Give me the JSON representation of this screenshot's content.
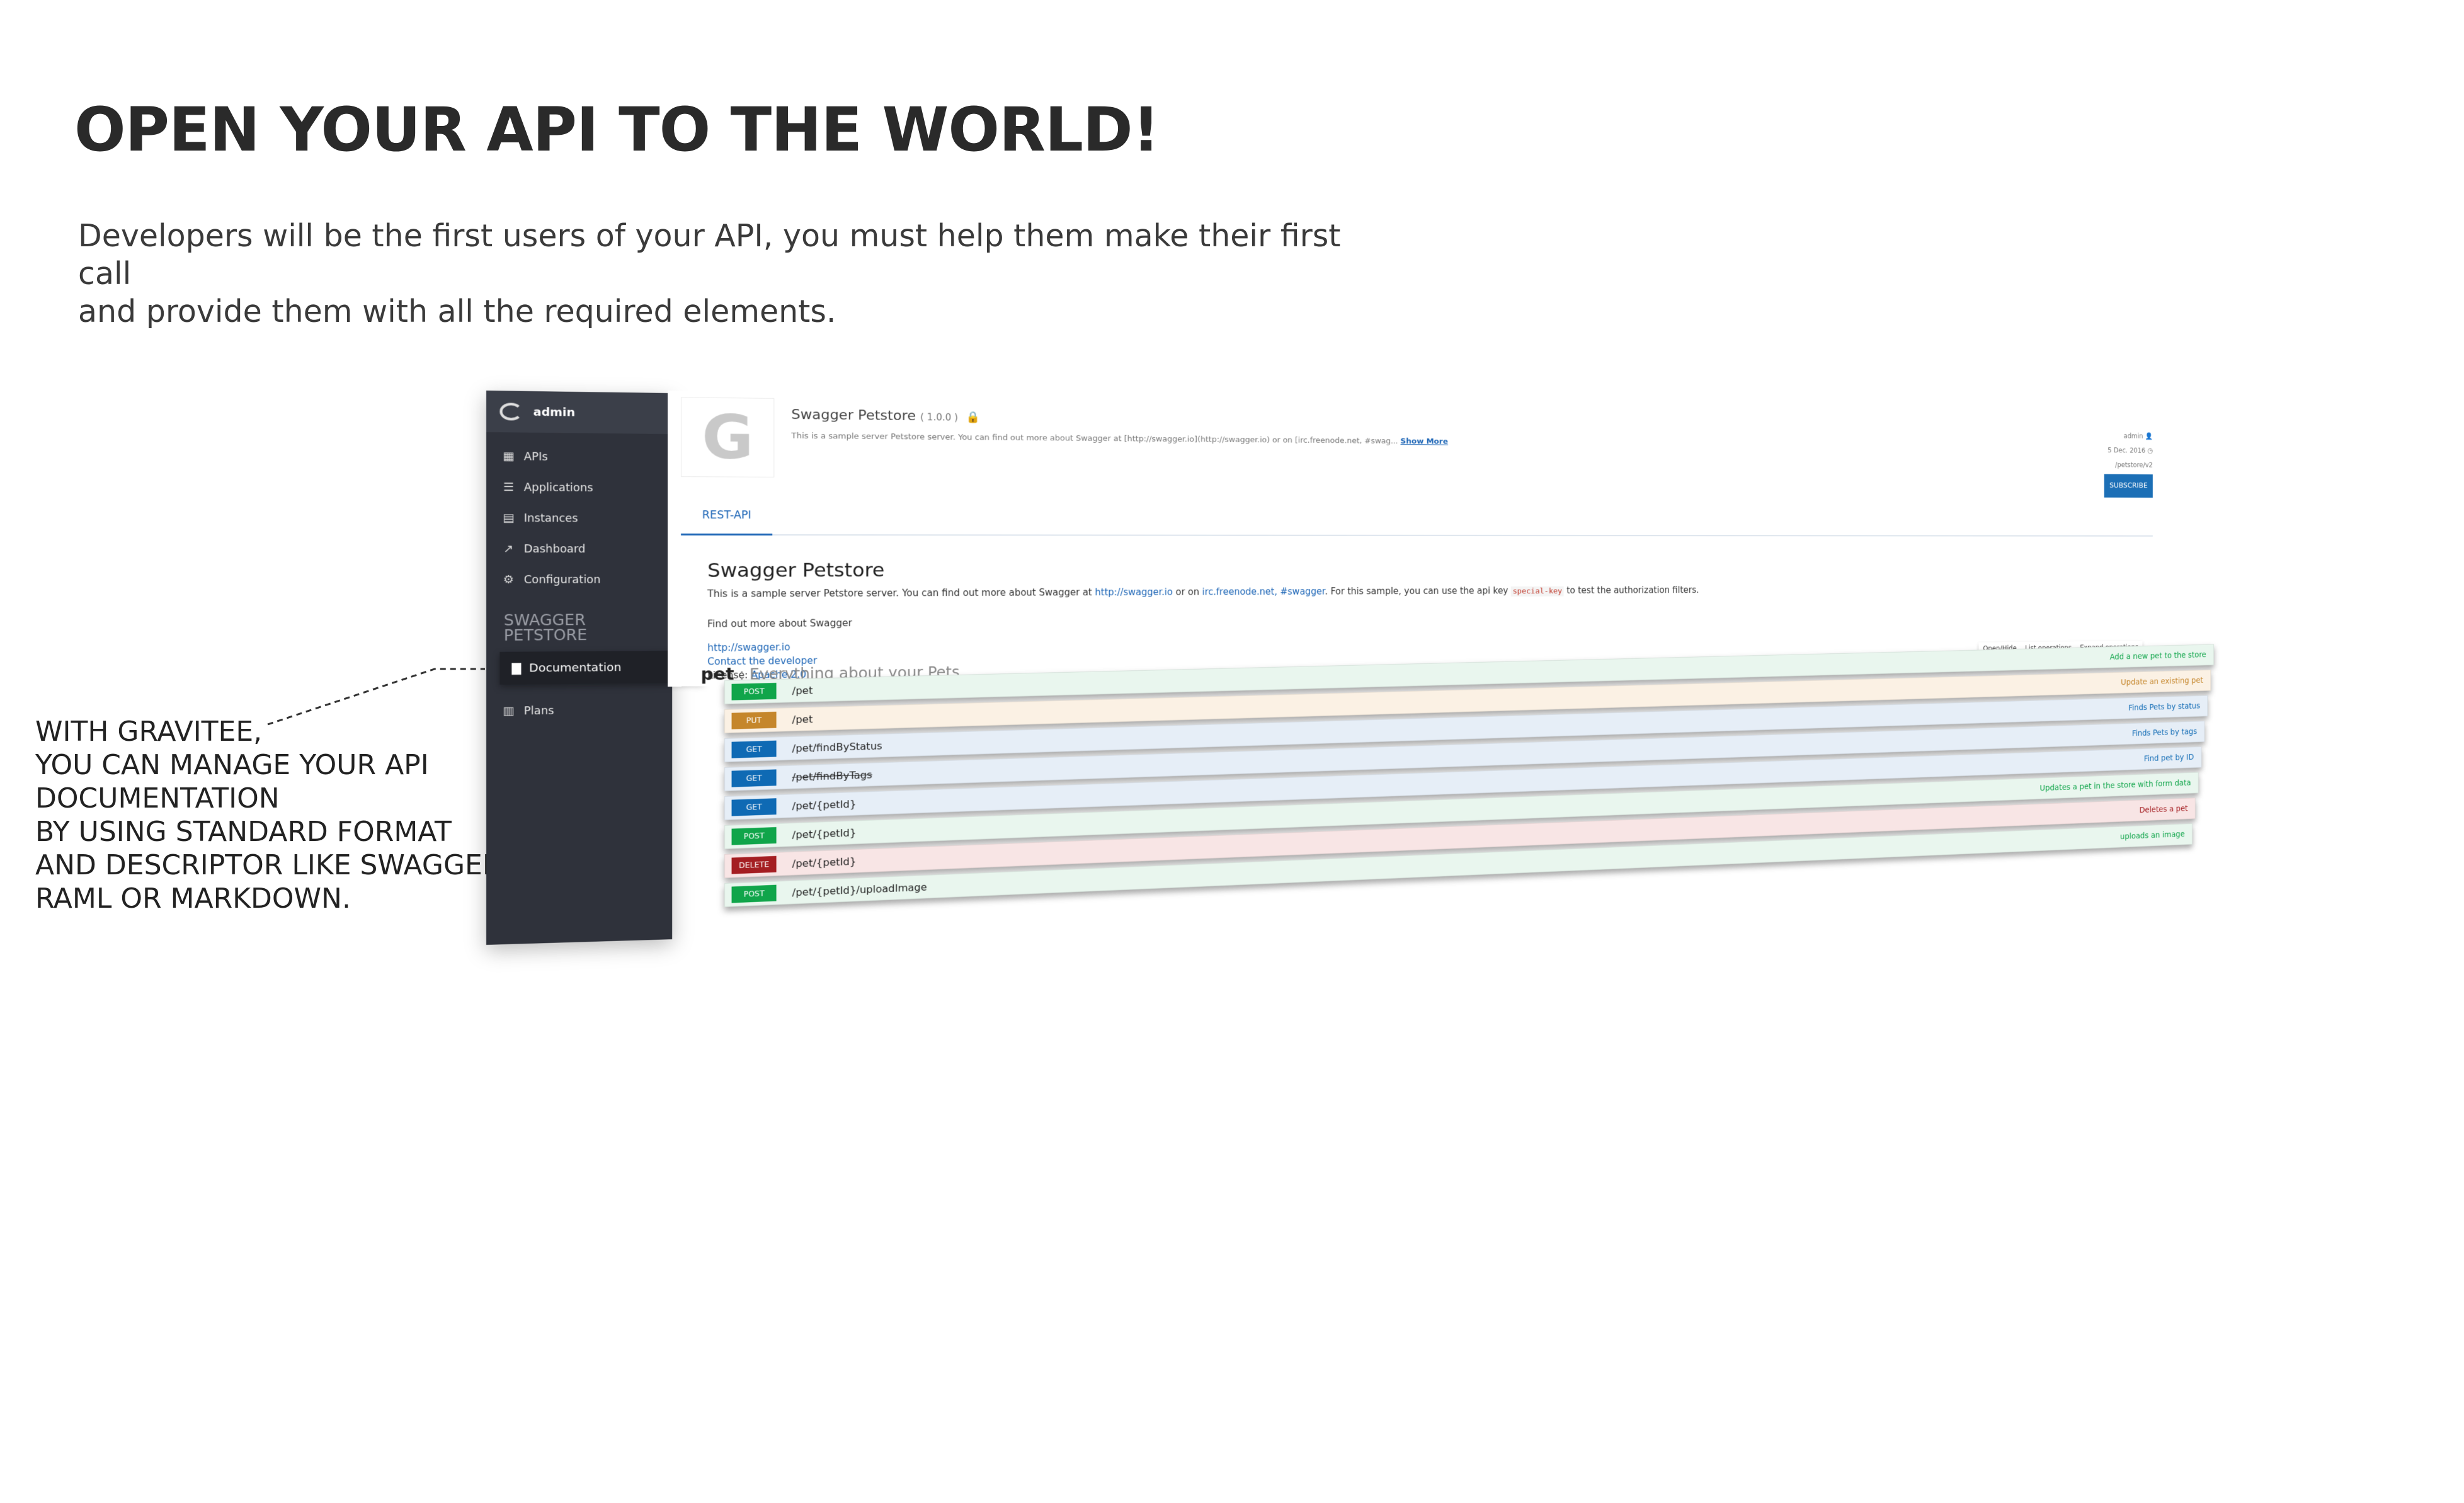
{
  "headline": "OPEN YOUR API TO THE WORLD!",
  "intro": [
    "Developers will be the first users of your API, you must help them make their first call",
    "and provide them with all the required elements."
  ],
  "callout": [
    "WITH GRAVITEE,",
    "YOU CAN MANAGE YOUR API",
    "DOCUMENTATION",
    "BY USING STANDARD FORMAT",
    "AND DESCRIPTOR LIKE SWAGGER,",
    "RAML OR MARKDOWN."
  ],
  "sidebar": {
    "user": "admin",
    "items": [
      {
        "label": "APIs",
        "icon": "grid-icon"
      },
      {
        "label": "Applications",
        "icon": "list-icon"
      },
      {
        "label": "Instances",
        "icon": "server-icon"
      },
      {
        "label": "Dashboard",
        "icon": "chart-icon"
      },
      {
        "label": "Configuration",
        "icon": "gear-icon"
      }
    ],
    "section_line1": "SWAGGER",
    "section_line2": "PETSTORE",
    "active_item": "Documentation",
    "plans_item": "Plans"
  },
  "api": {
    "name": "Swagger Petstore",
    "version": "( 1.0.0 )",
    "description": "This is a sample server Petstore server. You can find out more about Swagger at [http://swagger.io](http://swagger.io) or on [irc.freenode.net, #swag...",
    "show_more": "Show More",
    "owner": "admin",
    "date": "5 Dec. 2016",
    "path": "/petstore/v2",
    "subscribe": "SUBSCRIBE"
  },
  "tabs": [
    "REST-API"
  ],
  "swagger": {
    "title": "Swagger Petstore",
    "desc_1": "This is a sample server Petstore server. You can find out more about Swagger at ",
    "desc_link1": "http://swagger.io",
    "desc_2": " or on ",
    "desc_link2": "irc.freenode.net, #swagger",
    "desc_3": ". For this sample, you can use the api key ",
    "desc_code": "special-key",
    "desc_4": " to test the authorization filters.",
    "find_out": "Find out more about Swagger",
    "link_site": "http://swagger.io",
    "link_contact": "Contact the developer",
    "license_label": "License: ",
    "license_value": "Apache 2.0",
    "pet_tag": "pet",
    "pet_tag_desc": " : Everything about your Pets",
    "tools": [
      "Open/Hide",
      "List operations",
      "Expand operations"
    ]
  },
  "operations": [
    {
      "verb": "POST",
      "path": "/pet",
      "summary": "Add a new pet to the store",
      "bg": "#e9f6ee",
      "verb_color": "#10a54a",
      "summary_color": "#10a54a"
    },
    {
      "verb": "PUT",
      "path": "/pet",
      "summary": "Update an existing pet",
      "bg": "#fbf1e4",
      "verb_color": "#c5862b",
      "summary_color": "#c5862b"
    },
    {
      "verb": "GET",
      "path": "/pet/findByStatus",
      "summary": "Finds Pets by status",
      "bg": "#e6eef7",
      "verb_color": "#0f6ab4",
      "summary_color": "#0f6ab4"
    },
    {
      "verb": "GET",
      "path": "/pet/findByTags",
      "summary": "Finds Pets by tags",
      "bg": "#e6eef7",
      "verb_color": "#0f6ab4",
      "summary_color": "#0f6ab4",
      "deprecated": true
    },
    {
      "verb": "GET",
      "path": "/pet/{petId}",
      "summary": "Find pet by ID",
      "bg": "#e6eef7",
      "verb_color": "#0f6ab4",
      "summary_color": "#0f6ab4"
    },
    {
      "verb": "POST",
      "path": "/pet/{petId}",
      "summary": "Updates a pet in the store with form data",
      "bg": "#e9f6ee",
      "verb_color": "#10a54a",
      "summary_color": "#10a54a"
    },
    {
      "verb": "DELETE",
      "path": "/pet/{petId}",
      "summary": "Deletes a pet",
      "bg": "#f8e5e5",
      "verb_color": "#a41e22",
      "summary_color": "#a41e22"
    },
    {
      "verb": "POST",
      "path": "/pet/{petId}/uploadImage",
      "summary": "uploads an image",
      "bg": "#e9f6ee",
      "verb_color": "#10a54a",
      "summary_color": "#10a54a"
    }
  ]
}
